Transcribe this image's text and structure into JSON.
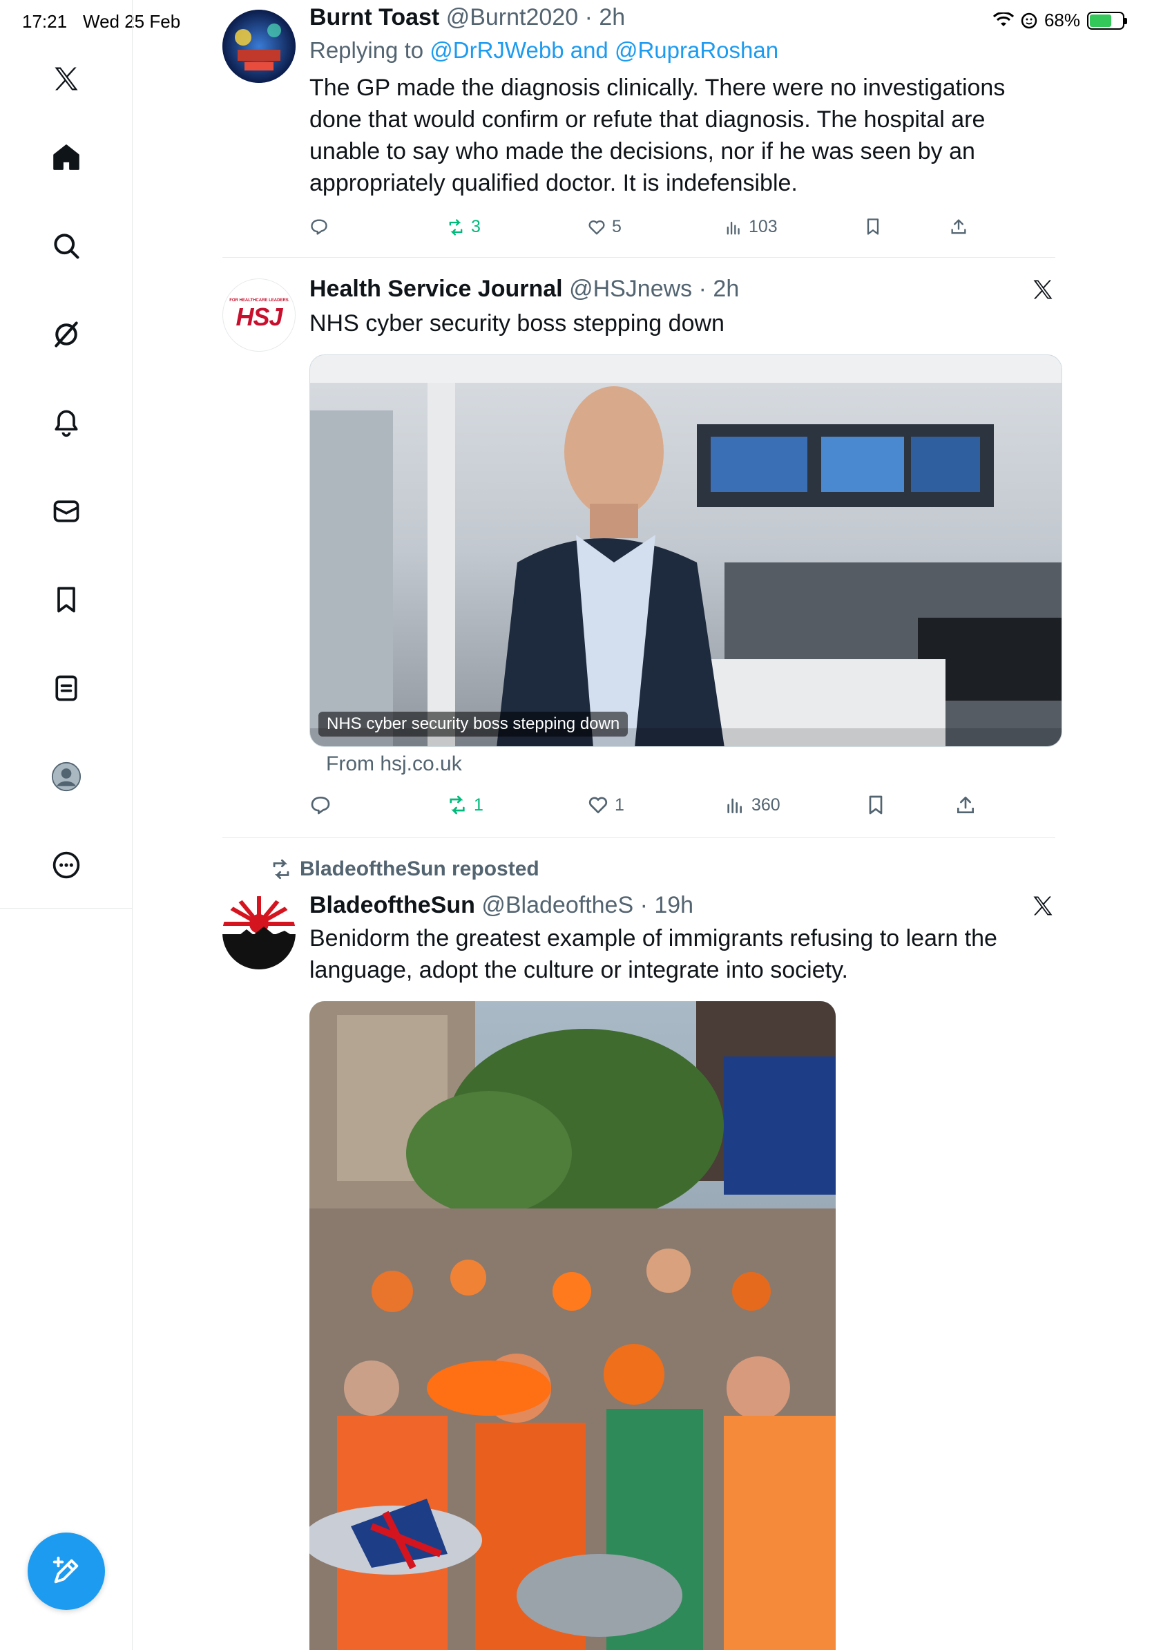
{
  "status": {
    "time": "17:21",
    "date": "Wed 25 Feb",
    "battery_pct": "68%"
  },
  "sidebar": {
    "items": [
      {
        "name": "x-logo"
      },
      {
        "name": "home"
      },
      {
        "name": "search"
      },
      {
        "name": "grok"
      },
      {
        "name": "notifications"
      },
      {
        "name": "messages"
      },
      {
        "name": "bookmarks"
      },
      {
        "name": "lists"
      },
      {
        "name": "profile"
      },
      {
        "name": "more"
      }
    ]
  },
  "tweets": [
    {
      "name": "Burnt Toast",
      "handle": "@Burnt2020",
      "time": "2h",
      "replying_prefix": "Replying to",
      "replying_to": "@DrRJWebb and @RupraRoshan",
      "text": "The GP made the diagnosis clinically. There were no investigations done that would confirm or refute that diagnosis. The hospital are unable to say who made the decisions, nor if he was seen by an appropriately qualified doctor. It is indefensible.",
      "retweets": "3",
      "likes": "5",
      "views": "103"
    },
    {
      "name": "Health Service Journal",
      "handle": "@HSJnews",
      "time": "2h",
      "avatar_text": "HSJ",
      "avatar_subtext": "FOR HEALTHCARE LEADERS",
      "text": "NHS cyber security boss stepping down",
      "card_caption": "NHS cyber security boss stepping down",
      "card_source": "From hsj.co.uk",
      "retweets": "1",
      "likes": "1",
      "views": "360"
    },
    {
      "reposted_by": "BladeoftheSun reposted",
      "name": "BladeoftheSun",
      "handle": "@BladeoftheS",
      "time": "19h",
      "text": "Benidorm the greatest example of immigrants refusing to learn the language, adopt the culture or integrate into society."
    }
  ],
  "colors": {
    "accent": "#1d9bf0",
    "retweet_green": "#00ba7c",
    "secondary_text": "#536471",
    "divider": "#e7e9ea"
  }
}
